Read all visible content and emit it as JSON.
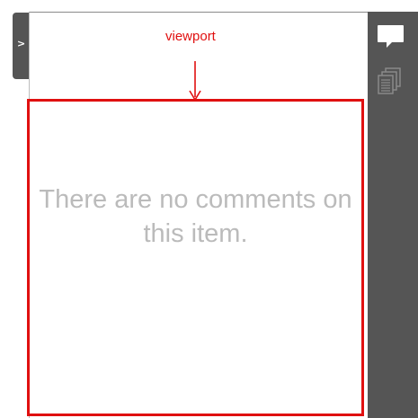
{
  "sidebar": {
    "collapse_glyph": ">"
  },
  "toolbar": {
    "buttons": [
      {
        "icon": "comment-bubble-icon",
        "active": true
      },
      {
        "icon": "pages-stack-icon",
        "active": false
      }
    ]
  },
  "annotation": {
    "label": "viewport",
    "color": "#e01010"
  },
  "comments": {
    "empty_message": "There are no comments on this item."
  },
  "colors": {
    "toolbar_bg": "#555555",
    "highlight": "#e01010",
    "muted_text": "#bbbbbb"
  }
}
